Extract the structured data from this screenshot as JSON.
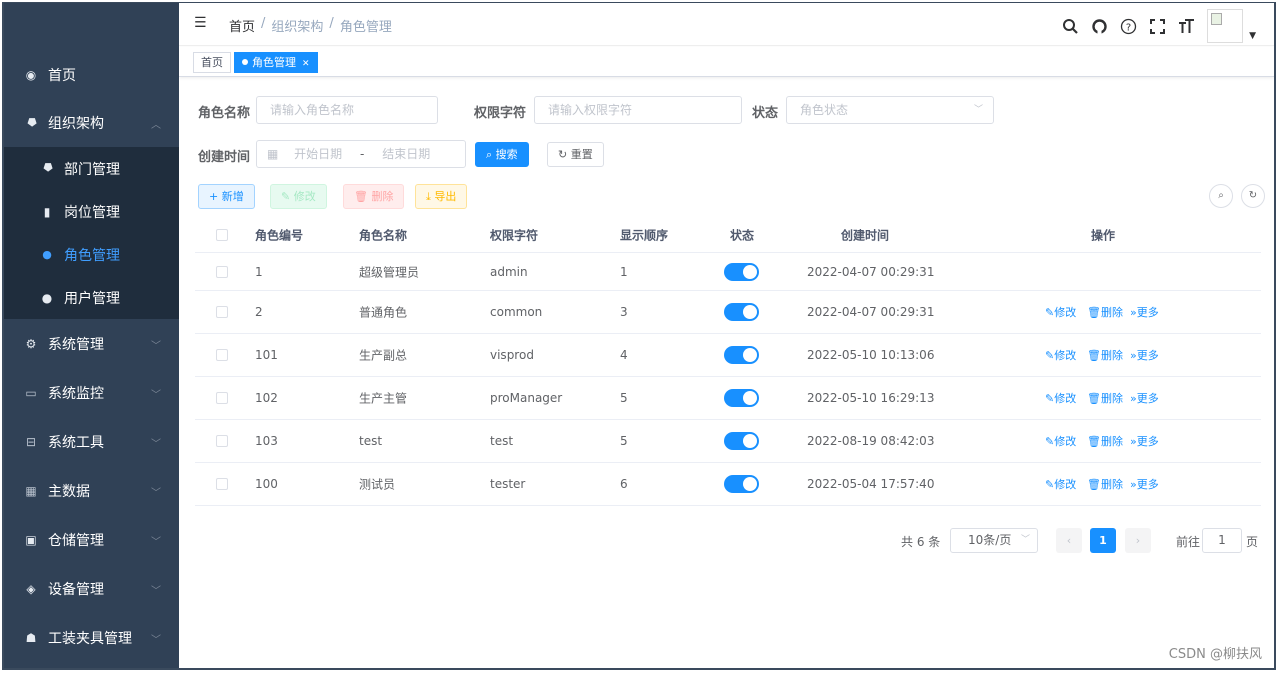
{
  "sidebar": {
    "items": [
      {
        "icon": "dashboard-icon",
        "glyph": "◉",
        "label": "首页"
      },
      {
        "icon": "tree-icon",
        "glyph": "⯂",
        "label": "组织架构"
      },
      {
        "icon": "tree-icon",
        "glyph": "⯂",
        "label": "部门管理"
      },
      {
        "icon": "post-icon",
        "glyph": "▮",
        "label": "岗位管理"
      },
      {
        "icon": "peoples-icon",
        "glyph": "👥",
        "label": "角色管理"
      },
      {
        "icon": "user-icon",
        "glyph": "👤",
        "label": "用户管理"
      },
      {
        "icon": "system-icon",
        "glyph": "⚙",
        "label": "系统管理"
      },
      {
        "icon": "monitor-icon",
        "glyph": "🖵",
        "label": "系统监控"
      },
      {
        "icon": "tool-icon",
        "glyph": "🧰",
        "label": "系统工具"
      },
      {
        "icon": "grid-icon",
        "glyph": "▦",
        "label": "主数据"
      },
      {
        "icon": "warehouse-icon",
        "glyph": "▣",
        "label": "仓储管理"
      },
      {
        "icon": "device-icon",
        "glyph": "◈",
        "label": "设备管理"
      },
      {
        "icon": "fixture-icon",
        "glyph": "☗",
        "label": "工装夹具管理"
      }
    ]
  },
  "navbar": {
    "breadcrumb": [
      "首页",
      "组织架构",
      "角色管理"
    ],
    "separator": "/"
  },
  "tags": {
    "home": "首页",
    "active": "角色管理"
  },
  "search": {
    "role_name_label": "角色名称",
    "role_name_placeholder": "请输入角色名称",
    "role_key_label": "权限字符",
    "role_key_placeholder": "请输入权限字符",
    "status_label": "状态",
    "status_placeholder": "角色状态",
    "created_label": "创建时间",
    "start_placeholder": "开始日期",
    "range_sep": "-",
    "end_placeholder": "结束日期",
    "search_btn": "搜索",
    "reset_btn": "重置"
  },
  "toolbar": {
    "add": "新增",
    "edit": "修改",
    "delete": "删除",
    "export": "导出"
  },
  "table": {
    "headers": {
      "role_id": "角色编号",
      "role_name": "角色名称",
      "role_key": "权限字符",
      "sort": "显示顺序",
      "status": "状态",
      "created": "创建时间",
      "actions": "操作"
    },
    "rows": [
      {
        "role_id": "1",
        "role_name": "超级管理员",
        "role_key": "admin",
        "sort": "1",
        "status": true,
        "created": "2022-04-07 00:29:31",
        "has_actions": false
      },
      {
        "role_id": "2",
        "role_name": "普通角色",
        "role_key": "common",
        "sort": "3",
        "status": true,
        "created": "2022-04-07 00:29:31",
        "has_actions": true
      },
      {
        "role_id": "101",
        "role_name": "生产副总",
        "role_key": "visprod",
        "sort": "4",
        "status": true,
        "created": "2022-05-10 10:13:06",
        "has_actions": true
      },
      {
        "role_id": "102",
        "role_name": "生产主管",
        "role_key": "proManager",
        "sort": "5",
        "status": true,
        "created": "2022-05-10 16:29:13",
        "has_actions": true
      },
      {
        "role_id": "103",
        "role_name": "test",
        "role_key": "test",
        "sort": "5",
        "status": true,
        "created": "2022-08-19 08:42:03",
        "has_actions": true
      },
      {
        "role_id": "100",
        "role_name": "测试员",
        "role_key": "tester",
        "sort": "6",
        "status": true,
        "created": "2022-05-04 17:57:40",
        "has_actions": true
      }
    ],
    "row_actions": {
      "edit": "修改",
      "delete": "删除",
      "more": "更多"
    }
  },
  "pagination": {
    "total": "共 6 条",
    "page_size": "10条/页",
    "current": "1",
    "goto_label": "前往",
    "goto_value": "1",
    "page_unit": "页"
  },
  "watermark": "CSDN @柳扶风",
  "colors": {
    "sidebar_bg": "#304156",
    "submenu_bg": "#1f2d3d",
    "primary": "#1890ff"
  }
}
